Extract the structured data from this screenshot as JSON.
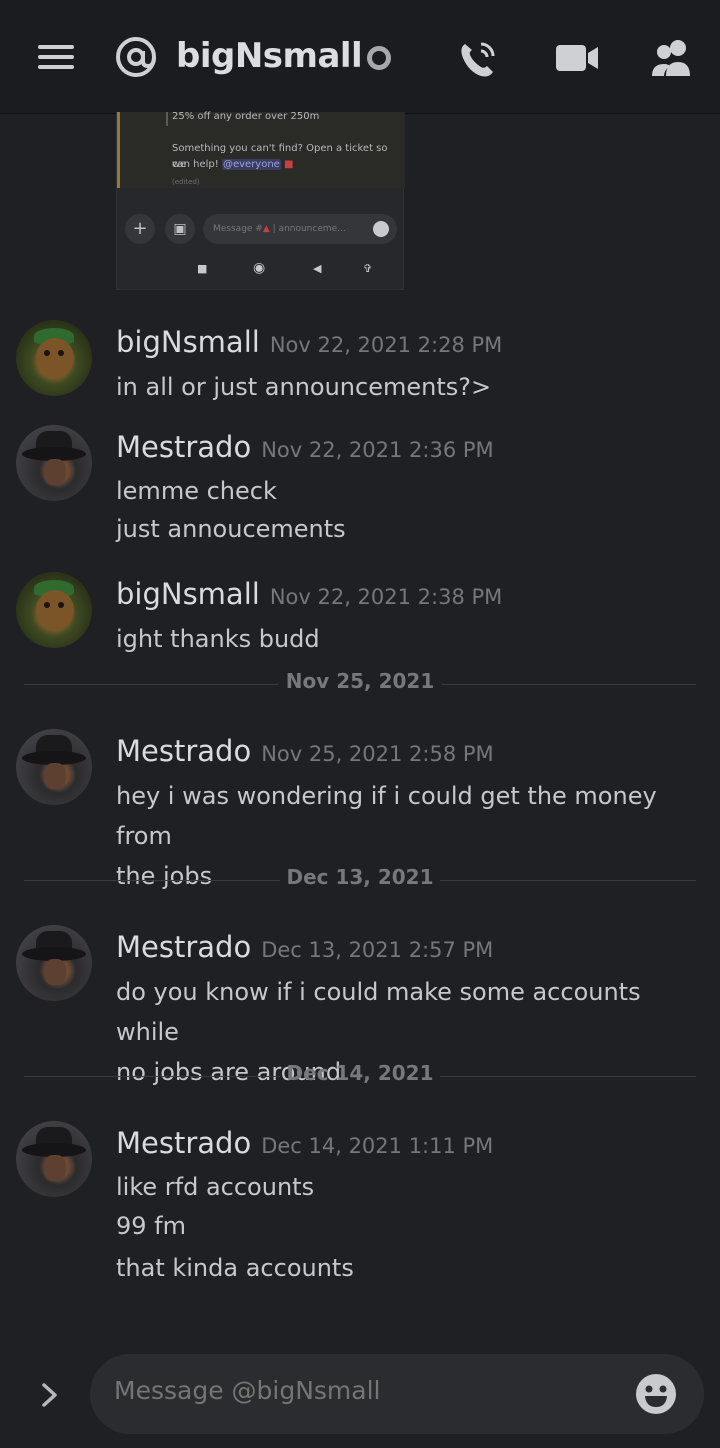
{
  "header": {
    "title": "bigNsmall"
  },
  "attachment": {
    "quote_line1": "25% off any order over 250m",
    "quote_line2": "Something you can't find? Open a ticket so we",
    "quote_line3_prefix": "can help!",
    "quote_mention": "@everyone",
    "quote_edited": "(edited)",
    "input_placeholder": "Message #",
    "input_channel": "| announceme..."
  },
  "messages": [
    {
      "author": "bigNsmall",
      "time": "Nov 22, 2021 2:28 PM",
      "lines": [
        "in all or just announcements?>"
      ]
    },
    {
      "author": "Mestrado",
      "time": "Nov 22, 2021 2:36 PM",
      "lines": [
        "lemme check",
        "just annoucements"
      ]
    },
    {
      "author": "bigNsmall",
      "time": "Nov 22, 2021 2:38 PM",
      "lines": [
        "ight thanks budd"
      ]
    },
    {
      "author": "Mestrado",
      "time": "Nov 25, 2021 2:58 PM",
      "lines": [
        "hey i was wondering if i could get the money from",
        "the jobs"
      ]
    },
    {
      "author": "Mestrado",
      "time": "Dec 13, 2021 2:57 PM",
      "lines": [
        "do you know if i could make some accounts while",
        "no jobs are around"
      ]
    },
    {
      "author": "Mestrado",
      "time": "Dec 14, 2021 1:11 PM",
      "lines": [
        "like rfd accounts",
        "99 fm",
        "that kinda accounts"
      ]
    }
  ],
  "dividers": [
    "Nov 25, 2021",
    "Dec 13, 2021",
    "Dec 14, 2021"
  ],
  "composer": {
    "placeholder": "Message @bigNsmall"
  }
}
